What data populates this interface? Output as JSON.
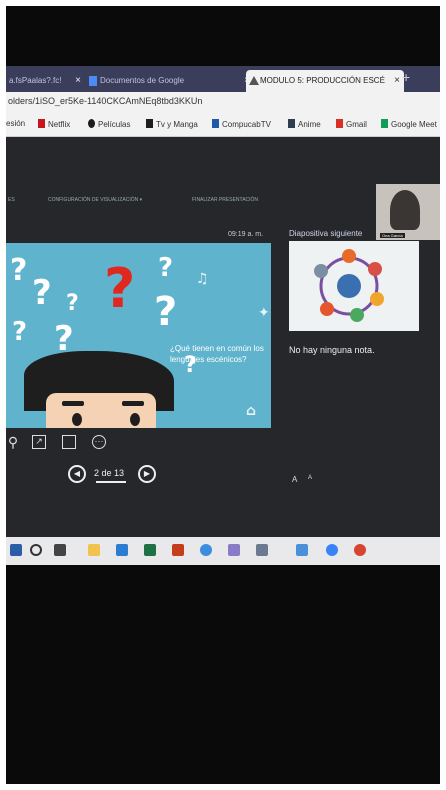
{
  "browser": {
    "tabs": [
      {
        "label": "a.fsPaalas?.fc!",
        "active": false
      },
      {
        "label": "Documentos de Google",
        "active": false
      },
      {
        "label": "MODULO 5: PRODUCCIÓN ESCÉ",
        "active": true
      }
    ],
    "new_tab_symbol": "+",
    "close_symbol": "×",
    "address_text": "olders/1iSO_er5Ke-1140CKCAmNEq8tbd3KKUn"
  },
  "bookmarks": [
    {
      "label": "esión",
      "icon": "none"
    },
    {
      "label": "Netflix",
      "icon": "netflix-icon",
      "color": "#c4161c"
    },
    {
      "label": "Películas",
      "icon": "cuevana-icon",
      "color": "#1d1d1d"
    },
    {
      "label": "Tv y Manga",
      "icon": "tvmanga-icon",
      "color": "#1d1d1d"
    },
    {
      "label": "CompucabTV",
      "icon": "compucab-icon",
      "color": "#1f5aa6"
    },
    {
      "label": "Anime",
      "icon": "anime-icon",
      "color": "#2c3e50"
    },
    {
      "label": "Gmail",
      "icon": "gmail-icon",
      "color": "#d93025"
    },
    {
      "label": "Google Meet",
      "icon": "meet-icon",
      "color": "#0f9d58"
    }
  ],
  "presenter": {
    "toolbar": {
      "left_label": "ES",
      "view_settings": "CONFIGURACIÓN DE VISUALIZACIÓN ▾",
      "end_show": "FINALIZAR PRESENTACIÓN"
    },
    "clock": "09:19 a. m.",
    "slide": {
      "question": "¿Qué tienen en común los lenguajes escénicos?",
      "accent": "#5fb3cc"
    },
    "slide_counter": "2 de 13",
    "prev_symbol": "◀",
    "next_symbol": "▶",
    "more_symbol": "···",
    "next_slide_label": "Diapositiva siguiente",
    "notes_text": "No hay ninguna nota.",
    "font_increase": "A",
    "font_decrease": "A",
    "camera_label": "Ona García"
  },
  "colors": {
    "tabbar": "#3b3e5a",
    "presenter_bg": "#26272b",
    "taskbar": "#e9e9ec"
  }
}
